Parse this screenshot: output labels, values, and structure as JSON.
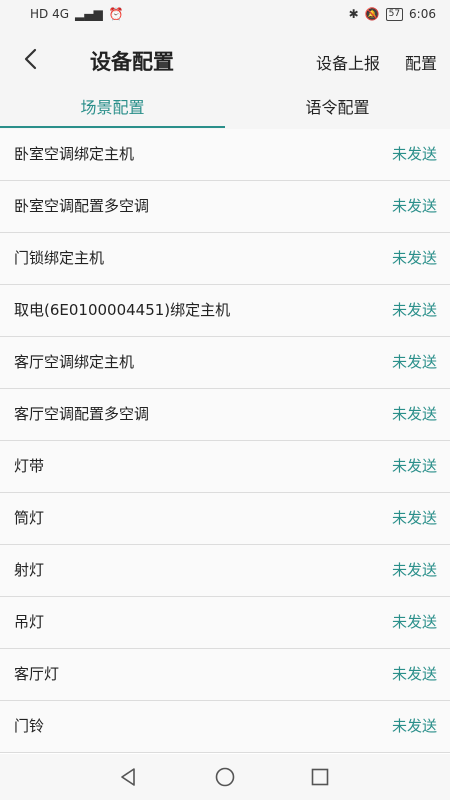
{
  "status_bar": {
    "left": "HD 4G",
    "battery": "57",
    "time": "6:06"
  },
  "header": {
    "title": "设备配置",
    "action_report": "设备上报",
    "action_config": "配置"
  },
  "tabs": [
    {
      "label": "场景配置",
      "active": true
    },
    {
      "label": "语令配置",
      "active": false
    }
  ],
  "list": {
    "items": [
      {
        "name": "卧室空调绑定主机",
        "status": "未发送"
      },
      {
        "name": "卧室空调配置多空调",
        "status": "未发送"
      },
      {
        "name": "门锁绑定主机",
        "status": "未发送"
      },
      {
        "name": "取电(6E0100004451)绑定主机",
        "status": "未发送"
      },
      {
        "name": "客厅空调绑定主机",
        "status": "未发送"
      },
      {
        "name": "客厅空调配置多空调",
        "status": "未发送"
      },
      {
        "name": "灯带",
        "status": "未发送"
      },
      {
        "name": "筒灯",
        "status": "未发送"
      },
      {
        "name": "射灯",
        "status": "未发送"
      },
      {
        "name": "吊灯",
        "status": "未发送"
      },
      {
        "name": "客厅灯",
        "status": "未发送"
      },
      {
        "name": "门铃",
        "status": "未发送"
      }
    ]
  },
  "colors": {
    "accent": "#2a8f8a"
  },
  "icons": {
    "back": "back-arrow-icon",
    "nav_back": "triangle-back-icon",
    "nav_home": "circle-home-icon",
    "nav_recent": "square-recent-icon"
  }
}
